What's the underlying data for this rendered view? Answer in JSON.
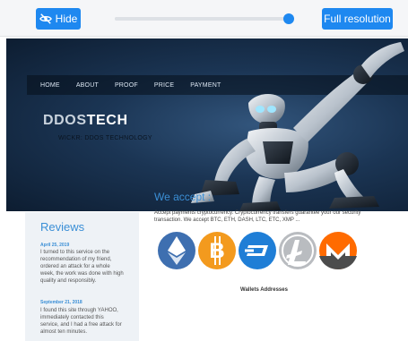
{
  "toolbar": {
    "hide_label": "Hide",
    "slider_level": 1.0,
    "full_label": "Full resolution",
    "accent": "#1e88f0"
  },
  "banner": {
    "nav": [
      "HOME",
      "ABOUT",
      "PROOF",
      "PRICE",
      "PAYMENT"
    ],
    "brand_prefix": "DDOS",
    "brand_suffix": "TECH",
    "tagline": "WICKR: DDOS TECHNOLOGY"
  },
  "reviews": {
    "title": "Reviews",
    "items": [
      {
        "date": "April 25, 2019",
        "text": "I turned to this service on the recommendation of my friend, ordered an attack for a whole week, the work was done with high quality and responsibly."
      },
      {
        "date": "September 21, 2018",
        "text": "I found this site through YAHOO, immediately contacted this service, and I had a free attack for almost ten minutes."
      }
    ]
  },
  "payment": {
    "title": "We accept :",
    "text": "Accept payments cryptocurrency. Cryptocurrency transfers guarantee your our security transaction. We accept BTC, ETH, DASH, LTC, ETC, XMP ...",
    "coins": [
      "ethereum-icon",
      "bitcoin-icon",
      "dash-icon",
      "litecoin-icon",
      "monero-icon"
    ],
    "wallets_title": "Wallets Addresses"
  }
}
